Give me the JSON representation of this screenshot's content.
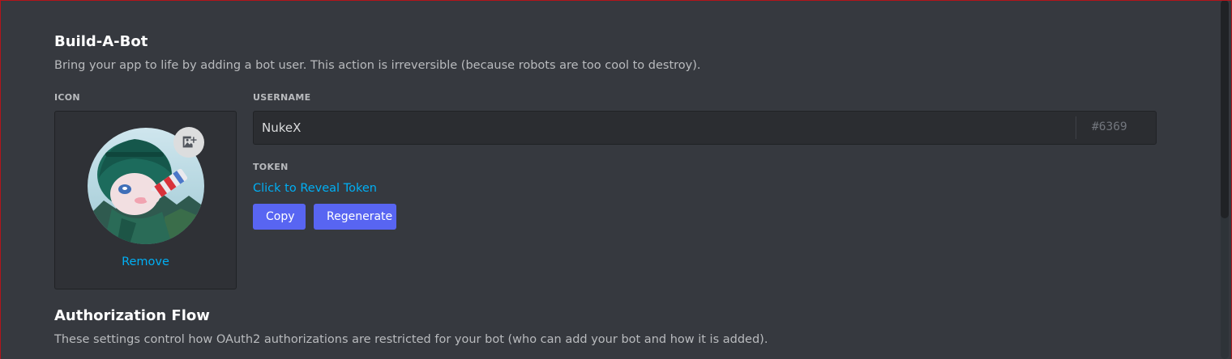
{
  "build_a_bot": {
    "title": "Build-A-Bot",
    "description": "Bring your app to life by adding a bot user. This action is irreversible (because robots are too cool to destroy)."
  },
  "icon": {
    "label": "ICON",
    "remove_label": "Remove",
    "upload_icon": "image-add-icon"
  },
  "username": {
    "label": "USERNAME",
    "value": "NukeX",
    "discriminator": "#6369"
  },
  "token": {
    "label": "TOKEN",
    "reveal_label": "Click to Reveal Token",
    "copy_label": "Copy",
    "regenerate_label": "Regenerate"
  },
  "authorization_flow": {
    "title": "Authorization Flow",
    "description": "These settings control how OAuth2 authorizations are restricted for your bot (who can add your bot and how it is added)."
  },
  "colors": {
    "background": "#36393f",
    "accent": "#5865f2",
    "link": "#00aff4"
  }
}
